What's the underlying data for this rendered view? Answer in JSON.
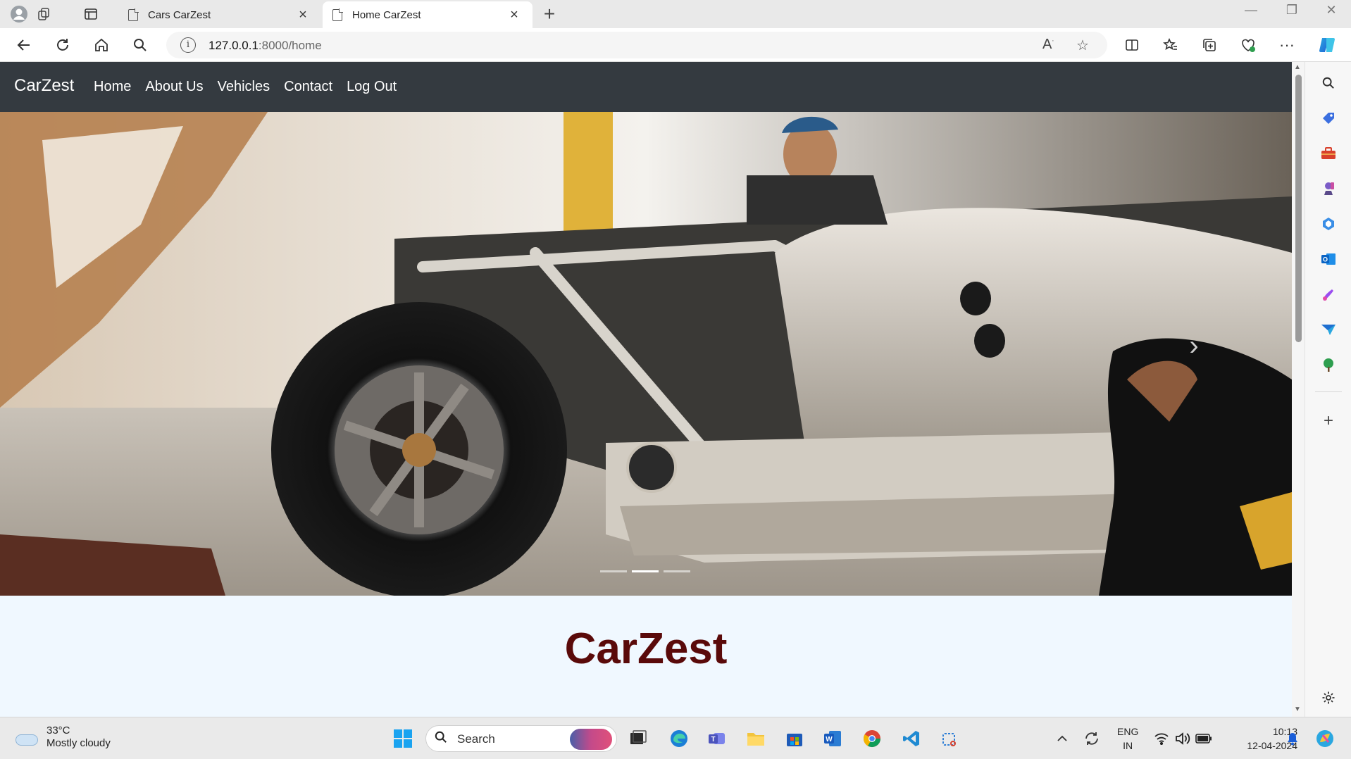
{
  "browser": {
    "tabs": [
      {
        "title": "Cars CarZest",
        "active": false
      },
      {
        "title": "Home CarZest",
        "active": true
      }
    ],
    "address": {
      "host": "127.0.0.1",
      "rest": ":8000/home"
    }
  },
  "site": {
    "brand": "CarZest",
    "nav": [
      "Home",
      "About Us",
      "Vehicles",
      "Contact",
      "Log Out"
    ],
    "carousel": {
      "slides": 3,
      "active_index": 1
    },
    "heading": "CarZest",
    "colors": {
      "navbar": "#343a40",
      "heading": "#5a0a0a",
      "section_bg": "#f0f8ff"
    }
  },
  "taskbar": {
    "weather": {
      "temp": "33°C",
      "desc": "Mostly cloudy"
    },
    "search_placeholder": "Search",
    "lang": {
      "line1": "ENG",
      "line2": "IN"
    },
    "clock": {
      "time": "10:13",
      "date": "12-04-2024"
    }
  }
}
